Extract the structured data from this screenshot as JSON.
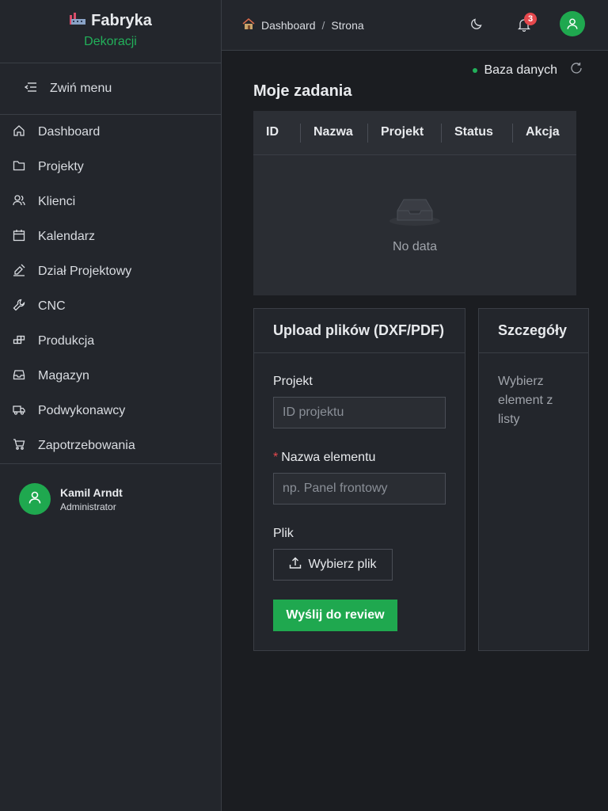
{
  "brand": {
    "title": "Fabryka",
    "subtitle": "Dekoracji",
    "logo_icon": "factory-icon"
  },
  "sidebar": {
    "collapse_label": "Zwiń menu",
    "items": [
      {
        "label": "Dashboard",
        "icon": "home-icon"
      },
      {
        "label": "Projekty",
        "icon": "folder-icon"
      },
      {
        "label": "Klienci",
        "icon": "users-icon"
      },
      {
        "label": "Kalendarz",
        "icon": "calendar-icon"
      },
      {
        "label": "Dział Projektowy",
        "icon": "design-icon"
      },
      {
        "label": "CNC",
        "icon": "wrench-icon"
      },
      {
        "label": "Produkcja",
        "icon": "blocks-icon"
      },
      {
        "label": "Magazyn",
        "icon": "inbox-icon"
      },
      {
        "label": "Podwykonawcy",
        "icon": "truck-icon"
      },
      {
        "label": "Zapotrzebowania",
        "icon": "cart-icon"
      }
    ]
  },
  "user": {
    "name": "Kamil Arndt",
    "role": "Administrator"
  },
  "header": {
    "breadcrumb": [
      "Dashboard",
      "Strona"
    ],
    "notification_count": "3"
  },
  "db_status": {
    "label": "Baza danych",
    "color": "#22b05a"
  },
  "tasks": {
    "title": "Moje zadania",
    "columns": [
      "ID",
      "Nazwa",
      "Projekt",
      "Status",
      "Akcja"
    ],
    "empty_text": "No data"
  },
  "upload": {
    "title": "Upload plików (DXF/PDF)",
    "project_label": "Projekt",
    "project_placeholder": "ID projektu",
    "name_label": "Nazwa elementu",
    "name_placeholder": "np. Panel frontowy",
    "file_label": "Plik",
    "file_button": "Wybierz plik",
    "submit_button": "Wyślij do review"
  },
  "details": {
    "title": "Szczegóły",
    "placeholder": "Wybierz element z listy"
  },
  "colors": {
    "accent": "#1fa84f",
    "badge": "#e5484d",
    "bg": "#1b1d21",
    "panel": "#23262c"
  }
}
